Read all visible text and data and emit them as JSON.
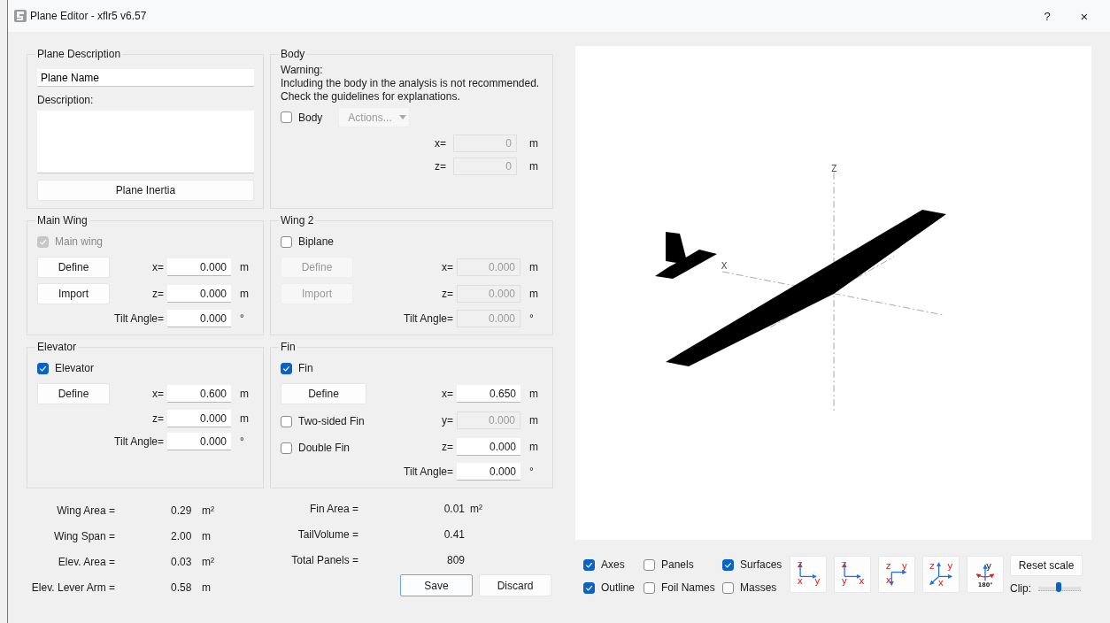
{
  "window": {
    "title": "Plane Editor - xflr5 v6.57",
    "controls": [
      "?",
      "×"
    ]
  },
  "plane_description": {
    "title": "Plane Description",
    "name_field": {
      "value": "Plane Name"
    },
    "description_label": "Description:",
    "inertia_button": "Plane Inertia"
  },
  "body": {
    "title": "Body",
    "warning": [
      "Warning:",
      "Including the body in the analysis is not recommended.",
      "Check the guidelines for explanations."
    ],
    "checkbox": {
      "label": "Body",
      "checked": false
    },
    "actions": {
      "label": "Actions...",
      "disabled": true
    },
    "fields": [
      {
        "label": "x=",
        "value": "0",
        "unit": "m",
        "disabled": true
      },
      {
        "label": "z=",
        "value": "0",
        "unit": "m",
        "disabled": true
      }
    ]
  },
  "surfaces": [
    {
      "title": "Main Wing",
      "checkbox": {
        "label": "Main wing",
        "checked": true,
        "disabled": true
      },
      "left_items": [
        {
          "kind": "button",
          "label": "Define",
          "disabled": false
        },
        {
          "kind": "button",
          "label": "Import",
          "disabled": false
        }
      ],
      "fields": [
        {
          "label": "x=",
          "value": "0.000",
          "unit": "m",
          "disabled": false
        },
        {
          "label": "z=",
          "value": "0.000",
          "unit": "m",
          "disabled": false
        },
        {
          "label": "Tilt Angle=",
          "value": "0.000",
          "unit": "°",
          "disabled": false
        }
      ]
    },
    {
      "title": "Wing 2",
      "checkbox": {
        "label": "Biplane",
        "checked": false,
        "disabled": false
      },
      "left_items": [
        {
          "kind": "button",
          "label": "Define",
          "disabled": true
        },
        {
          "kind": "button",
          "label": "Import",
          "disabled": true
        }
      ],
      "fields": [
        {
          "label": "x=",
          "value": "0.000",
          "unit": "m",
          "disabled": true
        },
        {
          "label": "z=",
          "value": "0.000",
          "unit": "m",
          "disabled": true
        },
        {
          "label": "Tilt Angle=",
          "value": "0.000",
          "unit": "°",
          "disabled": true
        }
      ]
    },
    {
      "title": "Elevator",
      "checkbox": {
        "label": "Elevator",
        "checked": true,
        "disabled": false
      },
      "left_items": [
        {
          "kind": "button",
          "label": "Define",
          "disabled": false
        }
      ],
      "fields": [
        {
          "label": "x=",
          "value": "0.600",
          "unit": "m",
          "disabled": false
        },
        {
          "label": "z=",
          "value": "0.000",
          "unit": "m",
          "disabled": false
        },
        {
          "label": "Tilt Angle=",
          "value": "0.000",
          "unit": "°",
          "disabled": false
        }
      ]
    },
    {
      "title": "Fin",
      "checkbox": {
        "label": "Fin",
        "checked": true,
        "disabled": false
      },
      "left_items": [
        {
          "kind": "button",
          "label": "Define",
          "disabled": false
        },
        {
          "kind": "checkbox",
          "label": "Two-sided Fin",
          "checked": false
        },
        {
          "kind": "checkbox",
          "label": "Double Fin",
          "checked": false
        }
      ],
      "fields": [
        {
          "label": "x=",
          "value": "0.650",
          "unit": "m",
          "disabled": false
        },
        {
          "label": "y=",
          "value": "0.000",
          "unit": "m",
          "disabled": true
        },
        {
          "label": "z=",
          "value": "0.000",
          "unit": "m",
          "disabled": false
        },
        {
          "label": "Tilt Angle=",
          "value": "0.000",
          "unit": "°",
          "disabled": false
        }
      ]
    }
  ],
  "summary_left": [
    {
      "label": "Wing Area =",
      "value": "0.29",
      "unit": "m²"
    },
    {
      "label": "Wing Span =",
      "value": "2.00",
      "unit": "m"
    },
    {
      "label": "Elev. Area =",
      "value": "0.03",
      "unit": "m²"
    },
    {
      "label": "Elev. Lever Arm =",
      "value": "0.58",
      "unit": "m"
    }
  ],
  "summary_right": [
    {
      "label": "Fin Area =",
      "value": "0.01",
      "unit": "m²"
    },
    {
      "label": "TailVolume =",
      "value": "0.41"
    },
    {
      "label": "Total Panels =",
      "value": "809"
    }
  ],
  "dialog_buttons": [
    {
      "label": "Save",
      "default": true
    },
    {
      "label": "Discard",
      "default": false
    }
  ],
  "view": {
    "axis_labels": [
      "Z",
      "X"
    ]
  },
  "display_options": [
    {
      "label": "Axes",
      "checked": true
    },
    {
      "label": "Panels",
      "checked": false
    },
    {
      "label": "Surfaces",
      "checked": true
    },
    {
      "label": "Outline",
      "checked": true
    },
    {
      "label": "Foil Names",
      "checked": false
    },
    {
      "label": "Masses",
      "checked": false
    }
  ],
  "view_buttons": [
    {
      "kind": "front",
      "letters": [
        "z",
        "x",
        "y"
      ]
    },
    {
      "kind": "side",
      "letters": [
        "z",
        "y",
        "x"
      ]
    },
    {
      "kind": "top",
      "letters": [
        "z",
        "y",
        "x"
      ]
    },
    {
      "kind": "iso",
      "letters": [
        "z",
        "y",
        "x"
      ]
    },
    {
      "kind": "flip",
      "letters": [
        "y",
        "180°"
      ]
    }
  ],
  "reset_button": "Reset scale",
  "clip": {
    "label": "Clip:",
    "level": 0.48
  }
}
